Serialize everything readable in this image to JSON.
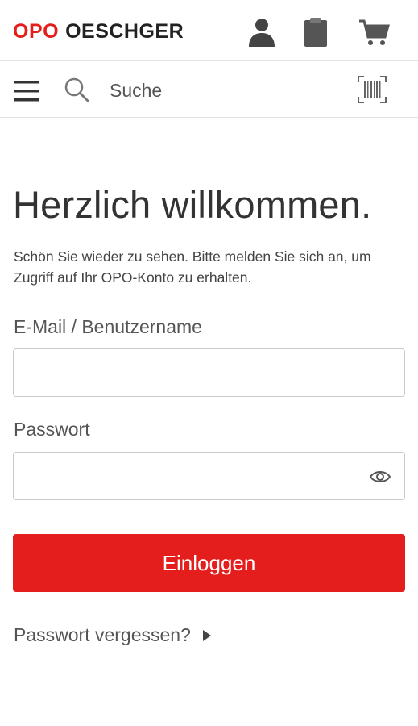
{
  "header": {
    "logo_part1": "OPO",
    "logo_part2": "OESCHGER",
    "icons": [
      "user-icon",
      "clipboard-icon",
      "cart-icon"
    ]
  },
  "search": {
    "placeholder": "Suche",
    "icons": [
      "menu-icon",
      "search-icon",
      "barcode-icon"
    ]
  },
  "login": {
    "title": "Herzlich willkommen.",
    "intro": "Schön Sie wieder zu sehen. Bitte melden Sie sich an, um Zugriff auf Ihr OPO-Konto zu erhalten.",
    "email_label": "E-Mail / Benutzername",
    "email_value": "",
    "password_label": "Passwort",
    "password_value": "",
    "submit_label": "Einloggen",
    "forgot_label": "Passwort vergessen?"
  },
  "colors": {
    "brand_red": "#e41e1c",
    "text": "#333333",
    "border": "#c9c9c9"
  }
}
